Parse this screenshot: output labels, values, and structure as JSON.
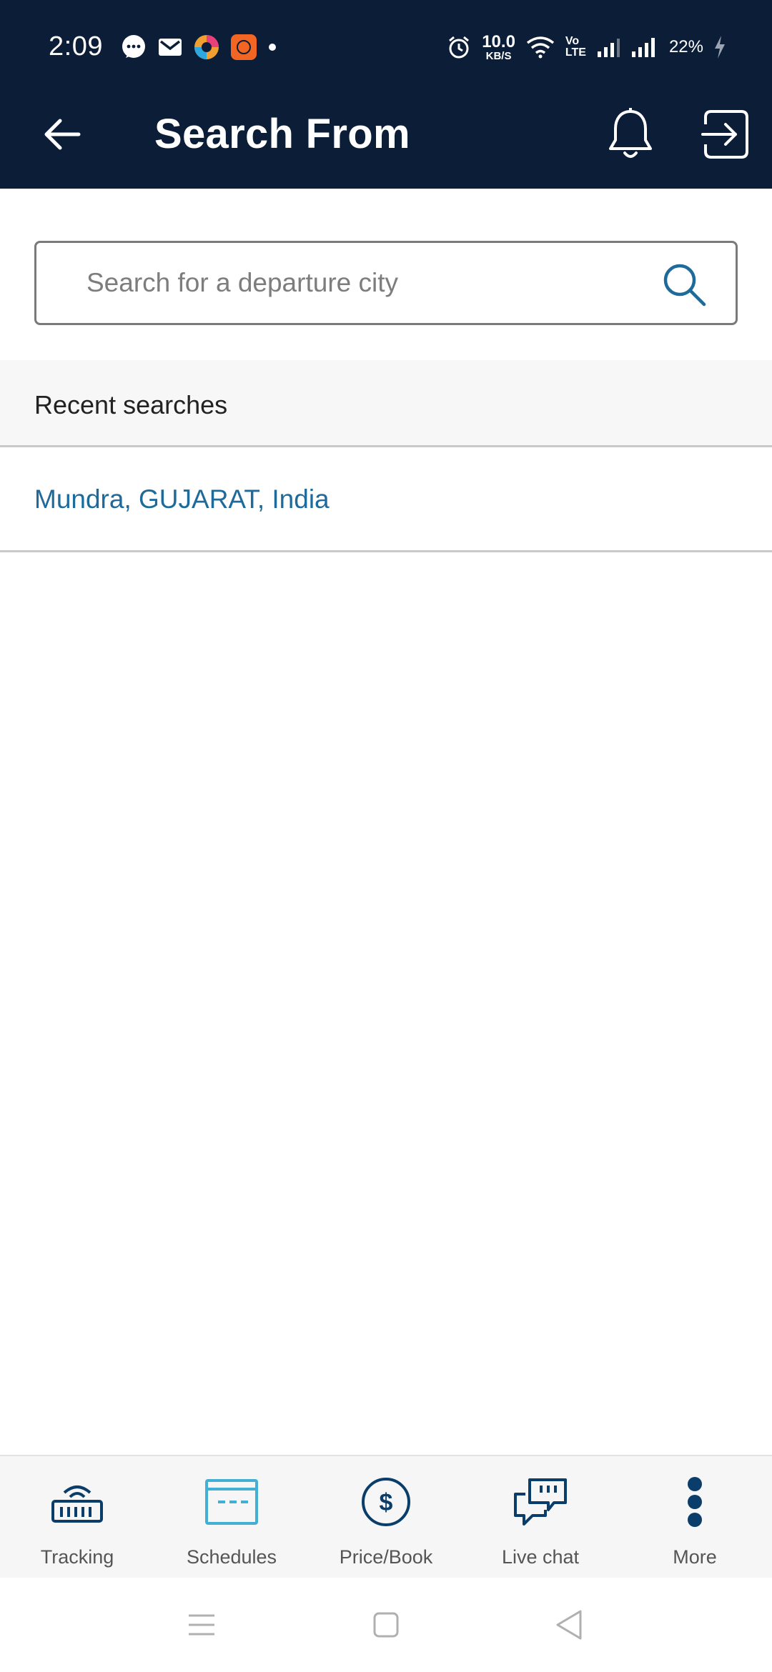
{
  "status_bar": {
    "time": "2:09",
    "net_speed_value": "10.0",
    "net_speed_unit": "KB/S",
    "volte_top": "Vo",
    "volte_bottom": "LTE",
    "battery": "22%"
  },
  "app_bar": {
    "title": "Search From"
  },
  "search": {
    "placeholder": "Search for a departure city",
    "value": ""
  },
  "recent": {
    "header": "Recent searches",
    "items": [
      {
        "label": "Mundra, GUJARAT, India"
      }
    ]
  },
  "bottom_nav": {
    "items": [
      {
        "label": "Tracking",
        "icon": "tracking-icon",
        "color": "#0b3d6b"
      },
      {
        "label": "Schedules",
        "icon": "schedules-icon",
        "color": "#42b0d5"
      },
      {
        "label": "Price/Book",
        "icon": "price-book-icon",
        "color": "#0b3d6b"
      },
      {
        "label": "Live chat",
        "icon": "live-chat-icon",
        "color": "#0b3d6b"
      },
      {
        "label": "More",
        "icon": "more-icon",
        "color": "#0b3d6b"
      }
    ]
  },
  "colors": {
    "header_bg": "#0b1d37",
    "link": "#1d6a9b",
    "accent": "#42b0d5"
  }
}
